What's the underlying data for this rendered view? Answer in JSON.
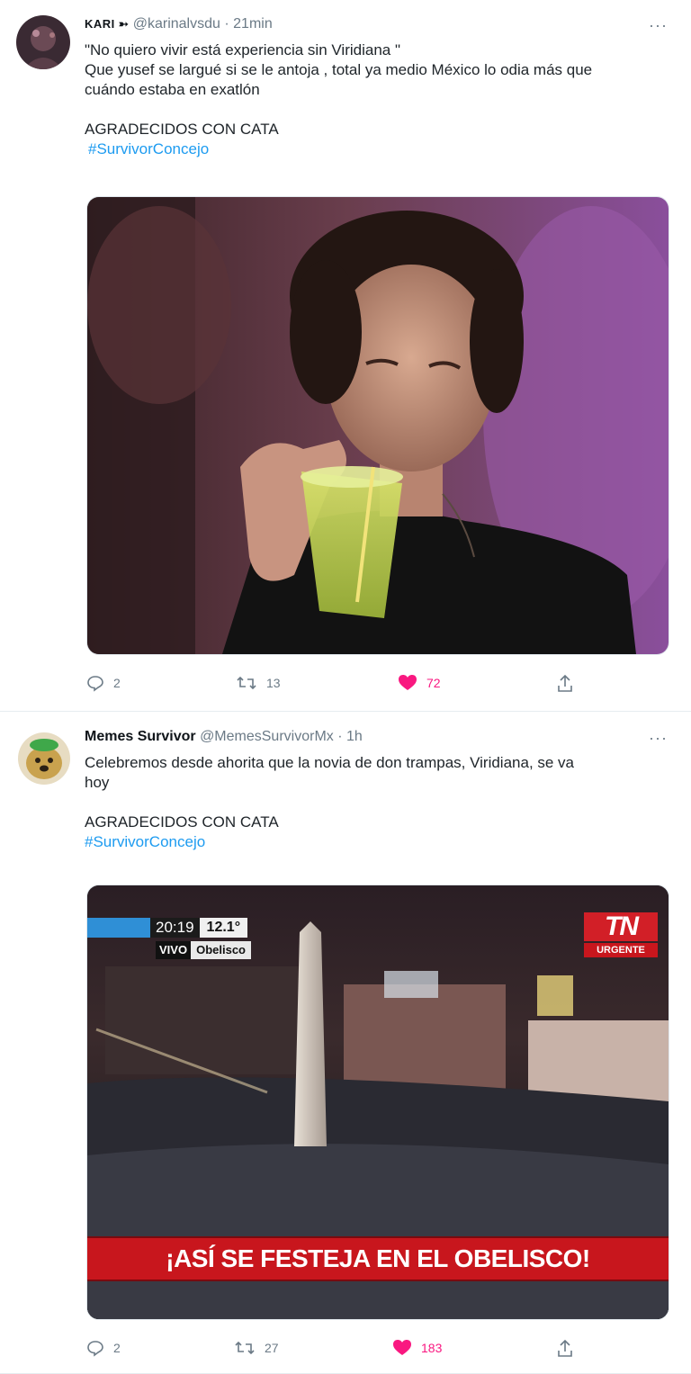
{
  "tweets": [
    {
      "display_name": "KARI ➳",
      "handle": "@karinalvsdu",
      "time": "21min",
      "more": "···",
      "text_lines": [
        "\"No quiero vivir está experiencia sin Viridiana \"",
        "Que yusef se largué si se le antoja , total ya medio México lo odia más que",
        "cuándo estaba en exatlón"
      ],
      "tag_line": "AGRADECIDOS CON CATA",
      "hashtag": "#SurvivorConcejo",
      "media_alt": "man drinking from plastic cup with straw",
      "stats": {
        "replies": "2",
        "retweets": "13",
        "likes": "72"
      }
    },
    {
      "display_name": "Memes Survivor",
      "handle": "@MemesSurvivorMx",
      "time": "1h",
      "more": "···",
      "text_lines": [
        "Celebremos desde ahorita que la novia de don trampas, Viridiana, se va",
        "hoy"
      ],
      "tag_line": "AGRADECIDOS CON CATA",
      "hashtag": "#SurvivorConcejo",
      "media": {
        "clock": "20:19",
        "temp": "12.1°",
        "vivo": "VIVO",
        "place": "Obelisco",
        "network": "TN",
        "urgent": "URGENTE",
        "banner": "¡ASÍ SE FESTEJA EN EL OBELISCO!"
      },
      "stats": {
        "replies": "2",
        "retweets": "27",
        "likes": "183"
      }
    }
  ],
  "colors": {
    "accent": "#1d9bf0",
    "like": "#f91880",
    "muted": "#6b7a86",
    "banner_red": "#c8161d"
  }
}
